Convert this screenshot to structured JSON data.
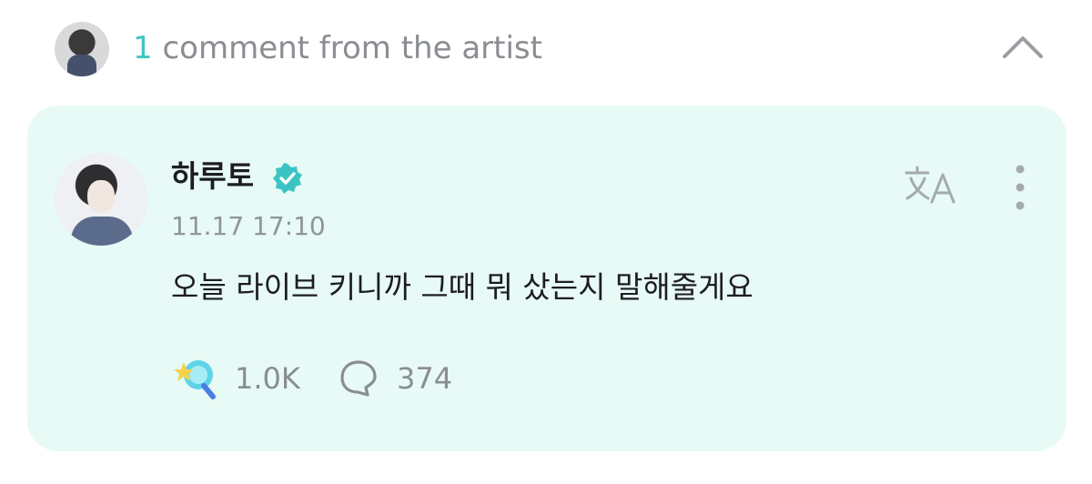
{
  "header": {
    "count": "1",
    "title": "comment from the artist"
  },
  "comment": {
    "author": "하루토",
    "timestamp": "11.17 17:10",
    "text": "오늘 라이브 키니까 그때 뭐 샀는지 말해줄게요",
    "reaction_count": "1.0K",
    "reply_count": "374"
  },
  "icons": {
    "collapse": "chevron-up-icon",
    "verified": "verified-badge-icon",
    "translate": "translate-icon",
    "more": "more-vertical-icon",
    "reaction": "star-wand-icon",
    "reply": "speech-bubble-icon"
  },
  "colors": {
    "accent": "#40c4c4",
    "card_background": "#e7faf6",
    "muted_text": "#8a8d92",
    "verified": "#3cc4c4"
  }
}
